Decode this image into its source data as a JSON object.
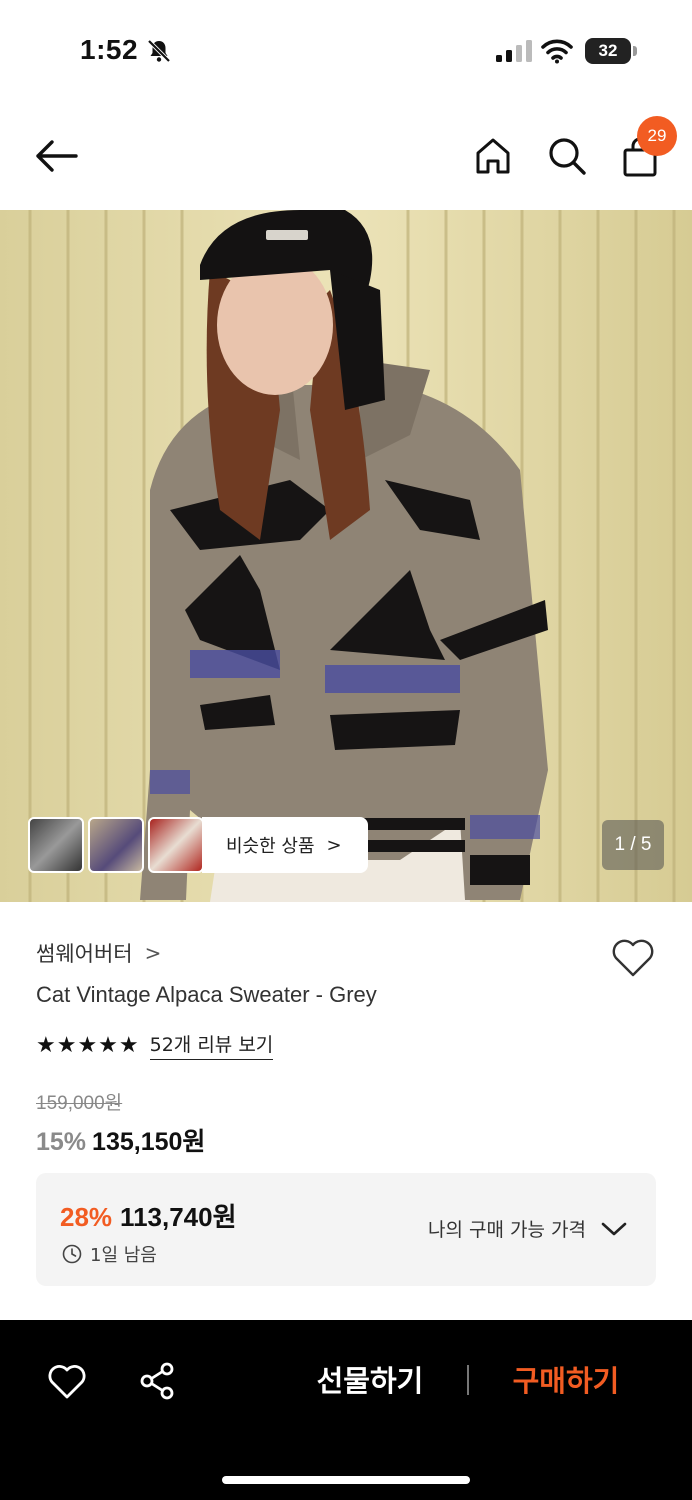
{
  "status": {
    "time": "1:52",
    "battery": "32"
  },
  "nav": {
    "cart_count": "29",
    "icons": [
      "back-arrow-icon",
      "home-icon",
      "search-icon",
      "shopping-bag-icon"
    ]
  },
  "gallery": {
    "similar_label": "비슷한 상품",
    "similar_chevron": ">",
    "counter": "1 / 5"
  },
  "product": {
    "brand": "썸웨어버터",
    "brand_chevron": ">",
    "name": "Cat Vintage Alpaca Sweater - Grey",
    "stars": "★★★★★",
    "review_link": "52개 리뷰 보기",
    "original_price": "159,000원",
    "discount_pct": "15%",
    "sale_price": "135,150원"
  },
  "best_price": {
    "discount_pct": "28%",
    "price": "113,740원",
    "time_left": "1일 남음",
    "my_price_label": "나의 구매 가능 가격"
  },
  "bottom_bar": {
    "gift_label": "선물하기",
    "buy_label": "구매하기"
  },
  "colors": {
    "accent": "#f25c22",
    "bottom_bar": "#000000",
    "sweater_grey": "#8f8475"
  }
}
